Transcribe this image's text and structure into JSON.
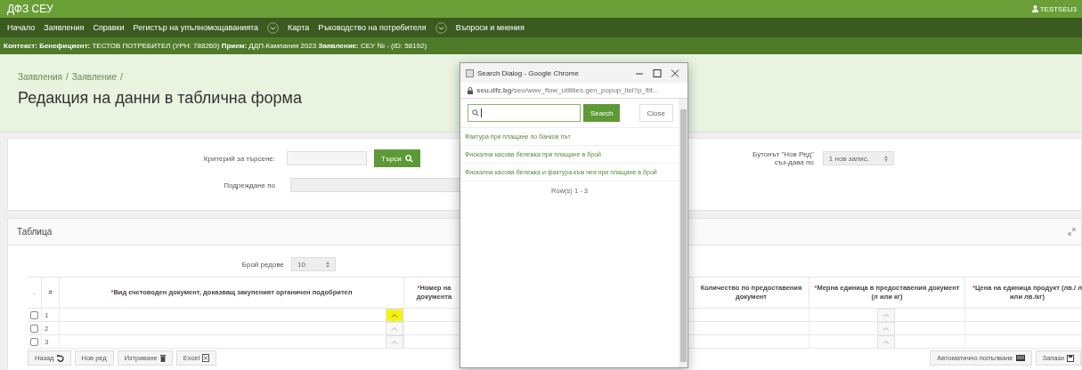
{
  "app": {
    "title": "ДФЗ СЕУ",
    "user": "TESTSEU3"
  },
  "nav": [
    {
      "label": "Начало",
      "has_menu": false
    },
    {
      "label": "Заявления",
      "has_menu": false
    },
    {
      "label": "Справки",
      "has_menu": false
    },
    {
      "label": "Регистър на упълномощаванията",
      "has_menu": true
    },
    {
      "label": "Карта",
      "has_menu": false
    },
    {
      "label": "Ръководство на потребителя",
      "has_menu": true
    },
    {
      "label": "Въпроси и мнения",
      "has_menu": false
    }
  ],
  "context": "**Контекст:** **Бенефициент:** ТЕСТОВ ПОТРЕБИТЕЛ (УРН: 788260) **Прием:** ДДП-Кампания 2023 **Заявление:** СЕУ № - (ID: 58192)",
  "breadcrumbs": [
    {
      "label": "Заявления",
      "separator": "/"
    },
    {
      "label": "Заявление",
      "separator": "/"
    }
  ],
  "page_title": "Редакция на данни в таблична форма",
  "search_form": {
    "criterion_label": "Критерий за търсене:",
    "search_button": "Търси",
    "order_label": "Подреждане по",
    "new_row_label": "Бутонът \"Нов Ред\" съз-дава по",
    "new_row_value": "1 нов запис."
  },
  "table_panel": {
    "title": "Таблица",
    "rows_label": "Брой редове",
    "rows_value": "10",
    "columns": [
      {
        "kind": "select",
        "label": "."
      },
      {
        "kind": "number",
        "label": "#"
      },
      {
        "kind": "picker",
        "mark": "*",
        "label": "Вид счетоводен документ, доказващ закупеният органичен подобрител"
      },
      {
        "kind": "text",
        "mark": "*",
        "label": "Номер на документа"
      },
      {
        "kind": "text",
        "label": "Количество по предоставения документ"
      },
      {
        "kind": "picker",
        "mark": "*",
        "label": "Мерна единица в предоставения документ (л или кг)"
      },
      {
        "kind": "text",
        "mark": "*",
        "label": "Цена на единица продукт (лв./ л или лв./кг)"
      }
    ],
    "rows": [
      {
        "number": "1",
        "checked": false,
        "picker_focused": true
      },
      {
        "number": "2",
        "checked": false,
        "picker_focused": false
      },
      {
        "number": "3",
        "checked": false,
        "picker_focused": false
      }
    ],
    "left_buttons": [
      {
        "kind": "undo",
        "label": "Назад"
      },
      {
        "kind": "plain",
        "label": "Нов ред"
      },
      {
        "kind": "trash",
        "label": "Изтриване"
      },
      {
        "kind": "excel",
        "label": "Excel"
      }
    ],
    "right_buttons": [
      {
        "kind": "fill",
        "label": "Автоматично попълване"
      },
      {
        "kind": "save",
        "label": "Запази"
      }
    ]
  },
  "popup": {
    "title": "Search Dialog - Google Chrome",
    "url": "**seu.dfz.bg**/seu/wwv_flow_utilities.gen_popup_list?p_filt...",
    "search_button": "Search",
    "close_button": "Close",
    "results": [
      "Фактура при плащане по банков път",
      "Фискална касова бележка при плащане в брой",
      "Фискална касова бележка и фактура към нея при плащане в брой"
    ],
    "pagination": "Row(s) 1 - 3"
  }
}
